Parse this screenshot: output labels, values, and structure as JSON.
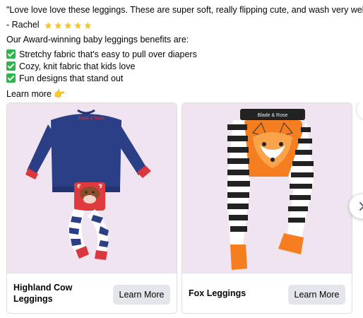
{
  "post": {
    "quote": "\"Love love love these leggings. These are super soft, really flipping cute, and wash very well.\"",
    "author": "- Rachel",
    "rating_stars": 5,
    "intro": "Our Award-winning baby leggings benefits are:",
    "benefits": [
      "Stretchy fabric that's easy to pull over diapers",
      "Cozy, knit fabric that kids love",
      "Fun designs that stand out"
    ],
    "learn_more": "Learn more"
  },
  "carousel": {
    "cards": [
      {
        "title": "Highland Cow Leggings",
        "button": "Learn More",
        "image_label": "Blade & Rose",
        "image_bg": "#efe4f0"
      },
      {
        "title": "Fox Leggings",
        "button": "Learn More",
        "image_label": "Blade & Rose",
        "image_bg": "#efe4f0"
      }
    ]
  },
  "colors": {
    "star": "#f6c21d",
    "check": "#2eb44a",
    "button_bg": "#e4e6eb",
    "card_border": "#dadde1"
  }
}
